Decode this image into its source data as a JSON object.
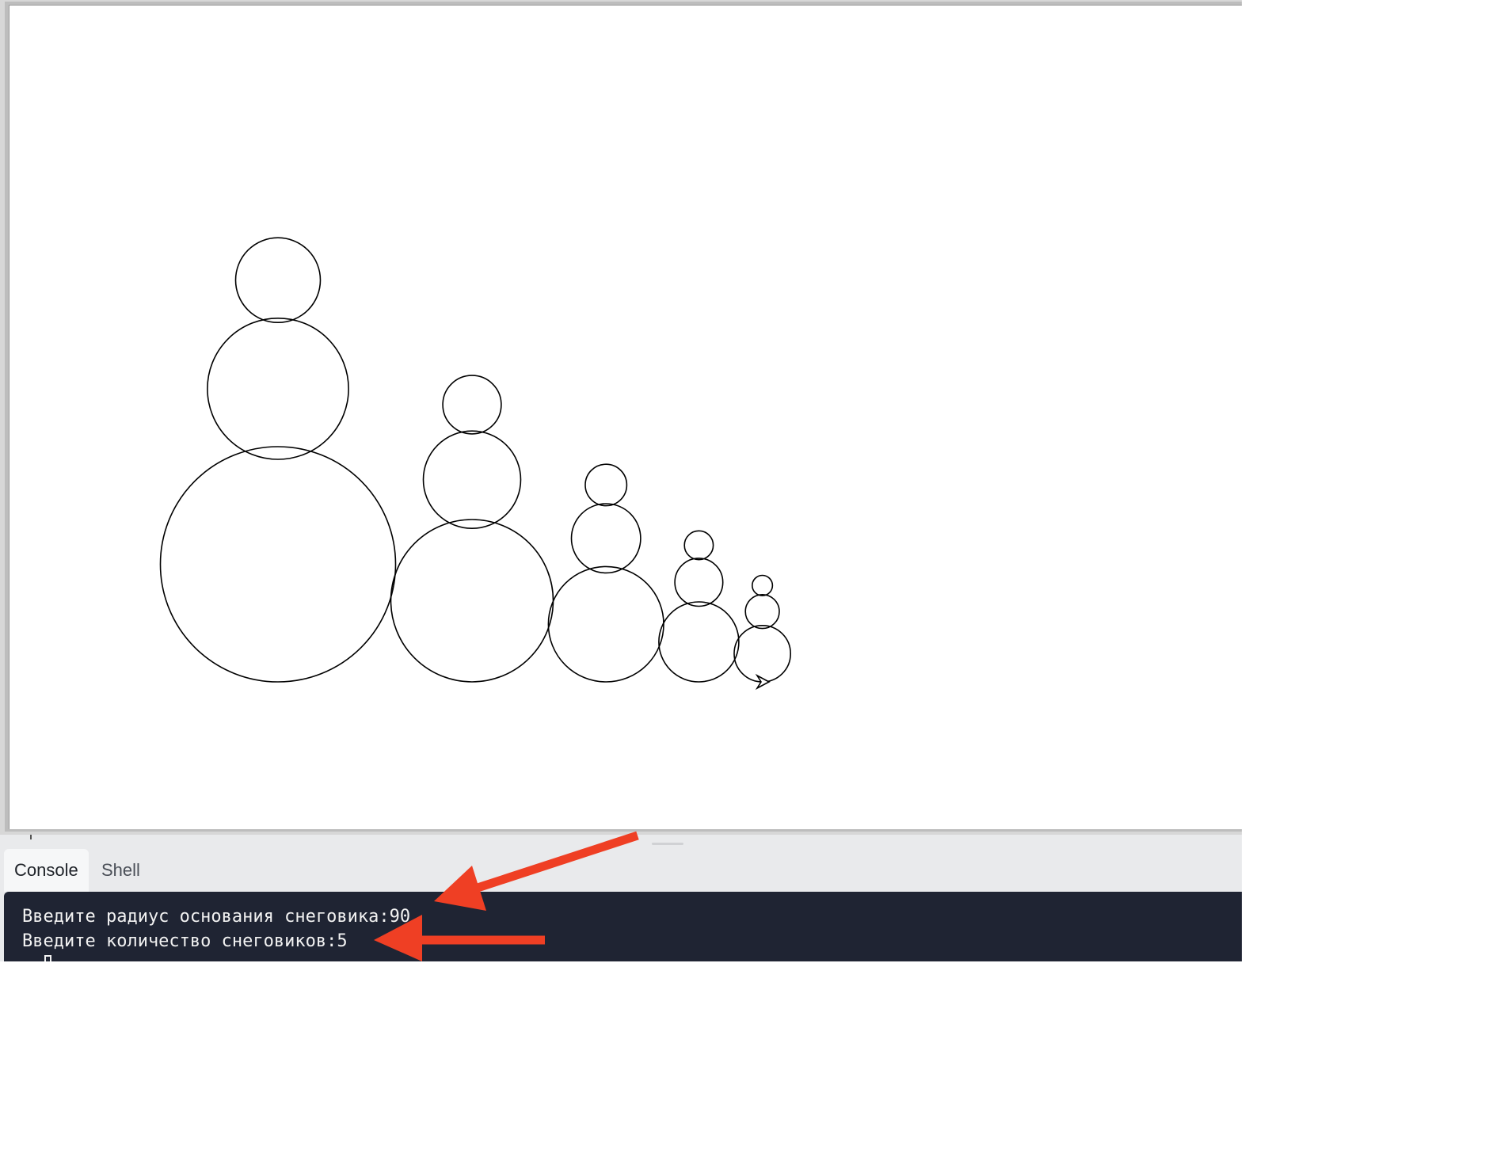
{
  "canvas": {
    "snowman_base_radius": 90,
    "snowman_count": 5,
    "turtle": "turtle-cursor-icon",
    "stroke_color": "#000000",
    "background": "#ffffff"
  },
  "tabs": [
    {
      "label": "Console",
      "active": true
    },
    {
      "label": "Shell",
      "active": false
    }
  ],
  "console": {
    "lines": [
      "Введите радиус основания снеговика:90",
      "Введите количество снеговиков:5"
    ],
    "cursor": "block-cursor-icon"
  },
  "annotations": {
    "arrow_color": "#ef3f24",
    "arrows": [
      "arrow-icon",
      "arrow-icon"
    ]
  }
}
